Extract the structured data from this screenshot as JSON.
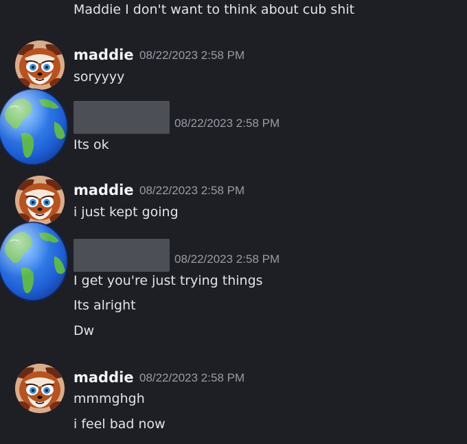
{
  "colors": {
    "background": "#1e1f25",
    "username": "#f2f3f5",
    "timestamp": "#9a9ca6",
    "message_text": "#e3e4e8",
    "redaction_bar": "#4d4f56"
  },
  "icons": {
    "maddie_avatar": "red-panda-avatar",
    "redacted_avatar": "earth-globe-avatar"
  },
  "messages": {
    "top_line": "Maddie I don't want to think about cub shit",
    "group1": {
      "username": "maddie",
      "timestamp": "08/22/2023 2:58 PM",
      "lines": [
        "soryyyy"
      ]
    },
    "group2": {
      "username": "",
      "username_redacted": true,
      "timestamp": "08/22/2023 2:58 PM",
      "lines": [
        "Its ok"
      ]
    },
    "group3": {
      "username": "maddie",
      "timestamp": "08/22/2023 2:58 PM",
      "lines": [
        "i just kept going"
      ]
    },
    "group4": {
      "username": "",
      "username_redacted": true,
      "timestamp": "08/22/2023 2:58 PM",
      "lines": [
        "I get you're just trying things",
        "Its alright",
        "Dw"
      ]
    },
    "group5": {
      "username": "maddie",
      "timestamp": "08/22/2023 2:58 PM",
      "lines": [
        "mmmghgh",
        "i feel bad now"
      ]
    }
  }
}
